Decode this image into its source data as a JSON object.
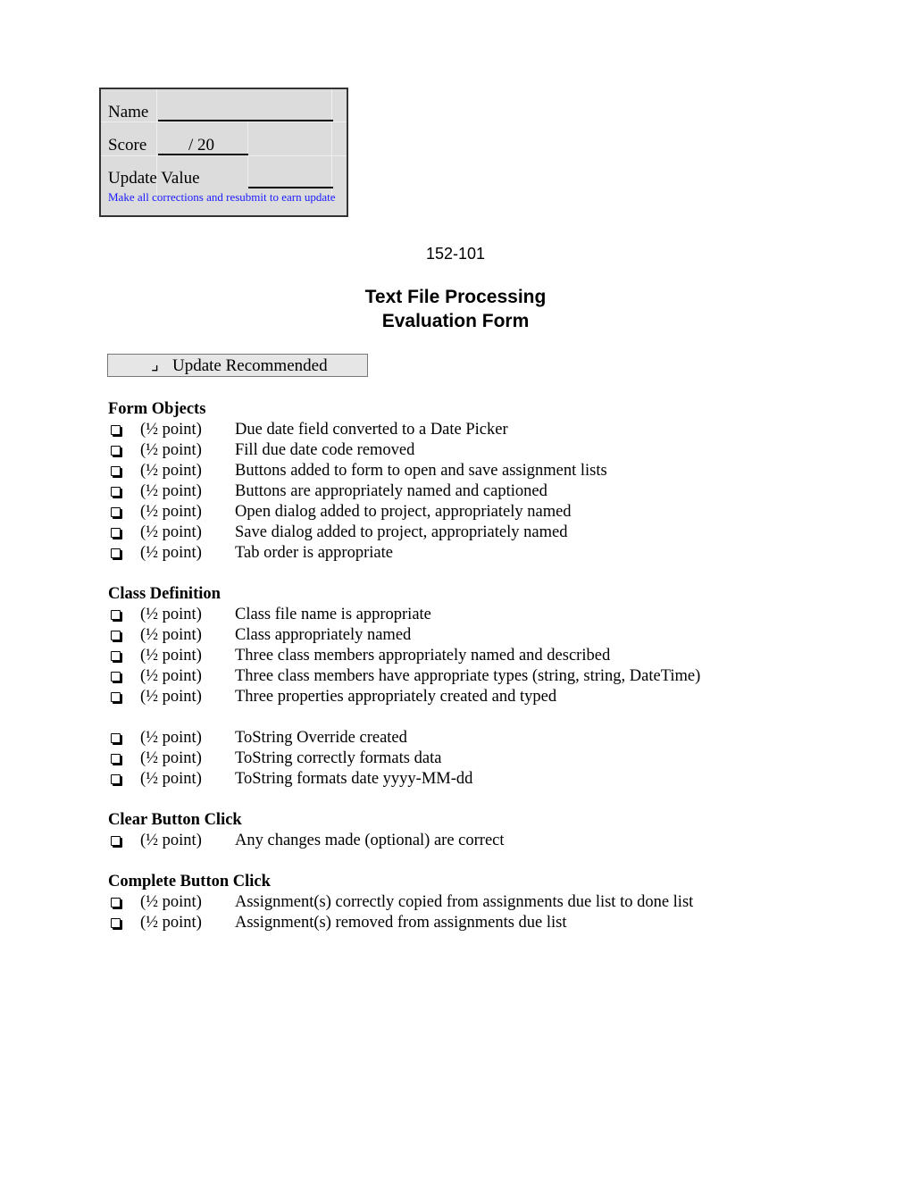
{
  "header_box": {
    "name_label": "Name",
    "score_label": "Score",
    "score_value": "/ 20",
    "update_value_label": "Update Value",
    "note": "Make all corrections and resubmit to earn update",
    "note_color": "#1a1aff"
  },
  "course_code": "152-101",
  "title_line1": "Text File Processing",
  "title_line2": "Evaluation Form",
  "update_recommended": {
    "mark": "⌟",
    "label": "Update Recommended"
  },
  "sections": [
    {
      "title": "Form Objects",
      "items": [
        {
          "points": "(½  point)",
          "text": "Due date field converted to a Date Picker"
        },
        {
          "points": "(½  point)",
          "text": "Fill due date code removed"
        },
        {
          "points": "(½  point)",
          "text": "Buttons added to form to open and save assignment lists"
        },
        {
          "points": "(½  point)",
          "text": "Buttons are appropriately named and captioned"
        },
        {
          "points": "(½  point)",
          "text": "Open dialog added to project, appropriately named"
        },
        {
          "points": "(½  point)",
          "text": "Save dialog added to project, appropriately named"
        },
        {
          "points": "(½  point)",
          "text": "Tab order is appropriate"
        }
      ]
    },
    {
      "title": "Class Definition",
      "items": [
        {
          "points": "(½  point)",
          "text": "Class file name is appropriate"
        },
        {
          "points": "(½  point)",
          "text": "Class appropriately named"
        },
        {
          "points": "(½  point)",
          "text": "Three class members appropriately named and described"
        },
        {
          "points": "(½  point)",
          "text": "Three class members have appropriate types (string, string, DateTime)"
        },
        {
          "points": "(½  point)",
          "text": "Three properties appropriately created and typed"
        }
      ],
      "extra_items": [
        {
          "points": "(½  point)",
          "text": "ToString Override created"
        },
        {
          "points": "(½  point)",
          "text": "ToString correctly formats data"
        },
        {
          "points": "(½  point)",
          "text": "ToString formats date yyyy-MM-dd"
        }
      ]
    },
    {
      "title": "Clear Button Click",
      "items": [
        {
          "points": "(½  point)",
          "text": "Any changes made (optional) are correct"
        }
      ]
    },
    {
      "title": "Complete Button Click",
      "items": [
        {
          "points": "(½  point)",
          "text": "Assignment(s) correctly copied from assignments due list to done list"
        },
        {
          "points": "(½  point)",
          "text": "Assignment(s) removed from assignments due list"
        }
      ]
    }
  ]
}
